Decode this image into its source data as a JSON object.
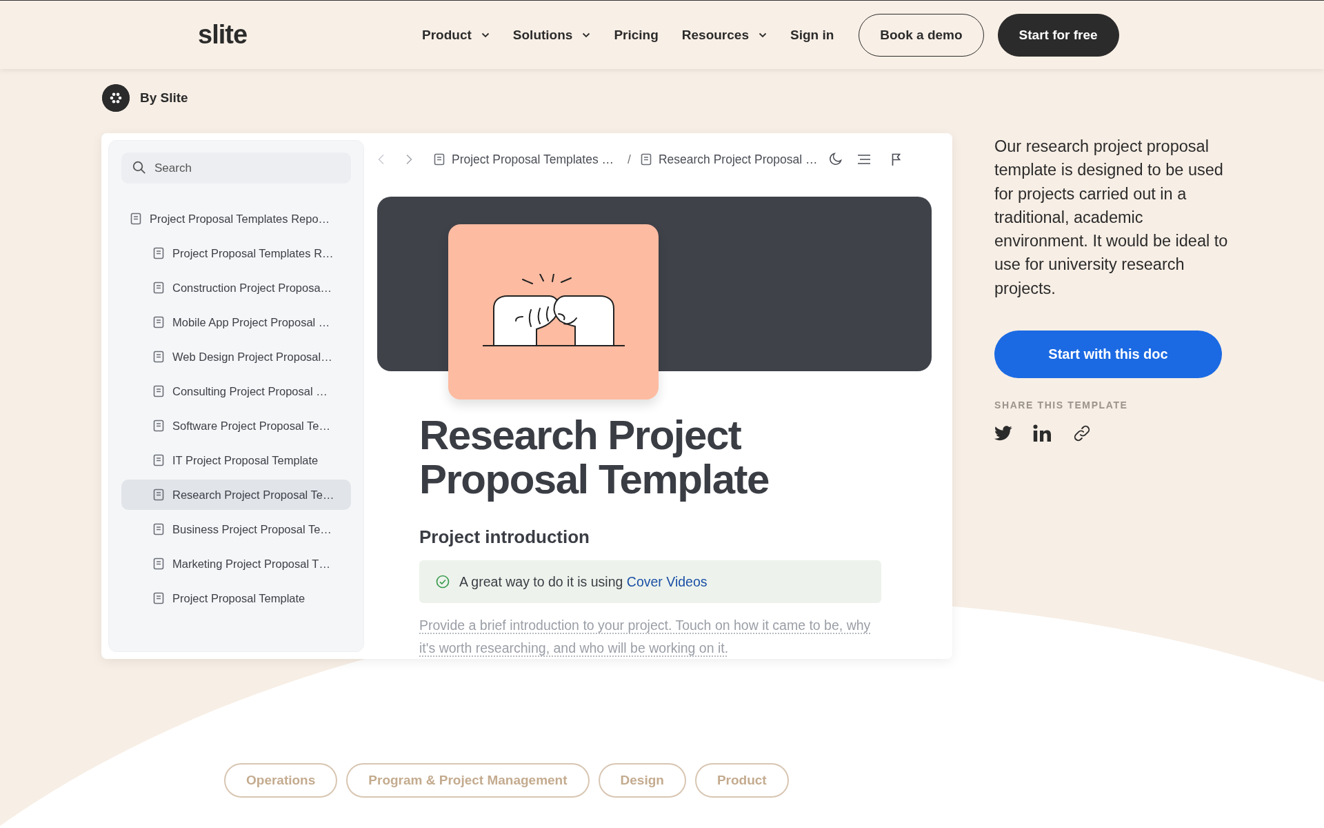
{
  "header": {
    "logo": "slite",
    "nav": [
      {
        "label": "Product",
        "dropdown": true
      },
      {
        "label": "Solutions",
        "dropdown": true
      },
      {
        "label": "Pricing",
        "dropdown": false
      },
      {
        "label": "Resources",
        "dropdown": true
      },
      {
        "label": "Sign in",
        "dropdown": false
      }
    ],
    "buttons": [
      {
        "label": "Book a demo",
        "kind": "outline"
      },
      {
        "label": "Start for free",
        "kind": "filled"
      }
    ]
  },
  "author": {
    "label": "By Slite"
  },
  "doc_preview": {
    "search": {
      "placeholder": "Search"
    },
    "tree": [
      {
        "label": "Project Proposal Templates Repo…",
        "selected": false,
        "children": [
          {
            "label": "Project Proposal Templates R…",
            "selected": false
          },
          {
            "label": "Construction Project Proposa…",
            "selected": false
          },
          {
            "label": "Mobile App Project Proposal …",
            "selected": false
          },
          {
            "label": "Web Design Project Proposal…",
            "selected": false
          },
          {
            "label": "Consulting Project Proposal …",
            "selected": false
          },
          {
            "label": "Software Project Proposal Te…",
            "selected": false
          },
          {
            "label": "IT Project Proposal Template",
            "selected": false
          },
          {
            "label": "Research Project Proposal Te…",
            "selected": true
          },
          {
            "label": "Business Project Proposal Te…",
            "selected": false
          },
          {
            "label": "Marketing Project Proposal T…",
            "selected": false
          },
          {
            "label": "Project Proposal Template",
            "selected": false
          }
        ]
      }
    ],
    "history": [
      {
        "kind": "back",
        "disabled": true
      },
      {
        "kind": "forward",
        "disabled": false
      }
    ],
    "breadcrumbs": [
      "Project Proposal Templates …",
      "Research Project Proposal …"
    ],
    "breadcrumb_separator": "/",
    "title": "Research Project Proposal Template",
    "heading": "Project introduction",
    "callout": {
      "text": "A great way to do it is using ",
      "link": "Cover Videos"
    },
    "body_placeholder": "Provide a brief introduction to your project. Touch on how it came to be, why it's worth researching, and who will be working on it."
  },
  "description": "Our research project proposal template is designed to be used for projects carried out in a traditional, academic environment. It would be ideal to use for university research projects.",
  "cta": {
    "label": "Start with this doc"
  },
  "share": {
    "label": "SHARE THIS TEMPLATE",
    "links": [
      {
        "kind": "twitter"
      },
      {
        "kind": "linkedin"
      },
      {
        "kind": "link"
      }
    ]
  },
  "tags": [
    "Operations",
    "Program & Project Management",
    "Design",
    "Product"
  ]
}
